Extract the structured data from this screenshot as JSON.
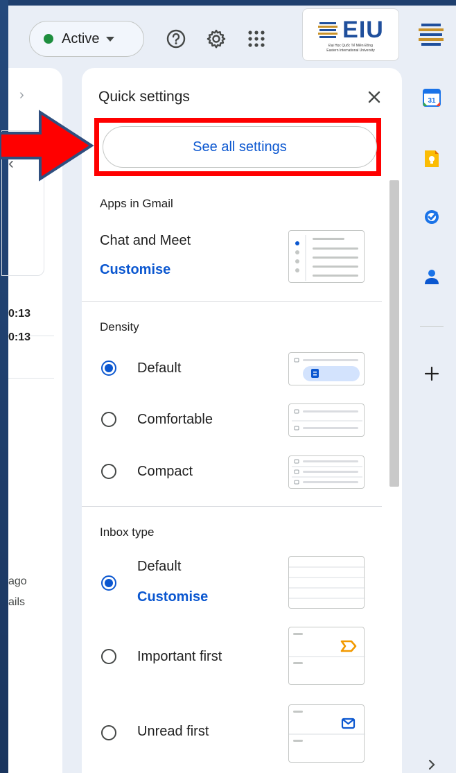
{
  "header": {
    "status_label": "Active",
    "logo_text": "EIU",
    "logo_sub1": "Đại Học Quốc Tế Miền Đông",
    "logo_sub2": "Eastern International University"
  },
  "left_pane": {
    "rows": [
      {
        "time": "0:13"
      },
      {
        "time": "0:13"
      }
    ],
    "ago": "ago",
    "ails": "ails"
  },
  "quick_settings": {
    "title": "Quick settings",
    "see_all_label": "See all settings",
    "apps_section": {
      "label": "Apps in Gmail",
      "item": "Chat and Meet",
      "link": "Customise"
    },
    "density_section": {
      "label": "Density",
      "options": [
        {
          "label": "Default",
          "selected": true
        },
        {
          "label": "Comfortable",
          "selected": false
        },
        {
          "label": "Compact",
          "selected": false
        }
      ]
    },
    "inbox_section": {
      "label": "Inbox type",
      "options": [
        {
          "label": "Default",
          "selected": true,
          "link": "Customise"
        },
        {
          "label": "Important first",
          "selected": false
        },
        {
          "label": "Unread first",
          "selected": false
        }
      ]
    }
  },
  "right_rail": {
    "icons": [
      "calendar-icon",
      "keep-icon",
      "tasks-icon",
      "contacts-icon",
      "add-icon"
    ],
    "calendar_day": "31"
  },
  "colors": {
    "accent": "#0b57d0",
    "annotation": "#ff0000",
    "active_status": "#1e8e3e"
  }
}
